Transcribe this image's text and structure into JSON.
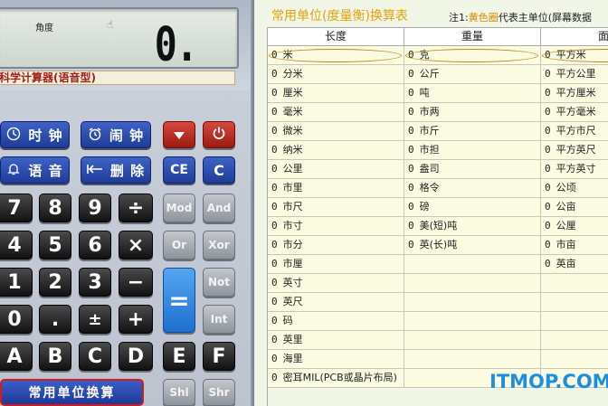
{
  "calculator": {
    "display": {
      "angle_label": "角度",
      "value": "0."
    },
    "model_name": "科学计算器(语音型)",
    "buttons": {
      "clock": "时 钟",
      "alarm": "闹 钟",
      "voice": "语 音",
      "delete": "删 除",
      "ce": "CE",
      "c": "C",
      "digits": [
        "7",
        "8",
        "9",
        "4",
        "5",
        "6",
        "1",
        "2",
        "3",
        "0",
        "."
      ],
      "divide": "÷",
      "multiply": "×",
      "minus": "−",
      "plus": "+",
      "plusminus": "±",
      "equals": "=",
      "hex": [
        "A",
        "B",
        "C",
        "D",
        "E",
        "F"
      ],
      "mod": "Mod",
      "and": "And",
      "or": "Or",
      "xor": "Xor",
      "not": "Not",
      "int": "Int",
      "shl": "Shl",
      "shr": "Shr",
      "unit_convert": "常用单位换算"
    },
    "icons": {
      "clock": "clock-icon",
      "alarm": "alarm-clock-icon",
      "voice": "bell-icon",
      "delete": "backspace-icon",
      "down": "triangle-down-icon",
      "power": "power-icon",
      "cursor": "hand-cursor-icon"
    }
  },
  "converter": {
    "title": "常用单位(度量衡)换算表",
    "note_prefix": "注1:",
    "note_highlight": "黄色圈",
    "note_suffix": "代表主单位(屏幕数据",
    "columns": [
      "长度",
      "重量",
      "面积"
    ],
    "rows": [
      [
        "米",
        "克",
        "平方米"
      ],
      [
        "分米",
        "公斤",
        "平方公里"
      ],
      [
        "厘米",
        "吨",
        "平方厘米"
      ],
      [
        "毫米",
        "市两",
        "平方毫米"
      ],
      [
        "微米",
        "市斤",
        "平方市尺"
      ],
      [
        "纳米",
        "市担",
        "平方英尺"
      ],
      [
        "公里",
        "盎司",
        "平方英寸"
      ],
      [
        "市里",
        "格令",
        "公顷"
      ],
      [
        "市尺",
        "磅",
        "公亩"
      ],
      [
        "市寸",
        "美(短)吨",
        "公厘"
      ],
      [
        "市分",
        "英(长)吨",
        "市亩"
      ],
      [
        "市厘",
        "",
        "英亩"
      ],
      [
        "英寸",
        "",
        ""
      ],
      [
        "英尺",
        "",
        ""
      ],
      [
        "码",
        "",
        ""
      ],
      [
        "英里",
        "",
        ""
      ],
      [
        "海里",
        "",
        ""
      ],
      [
        "密耳MIL(PCB或晶片布局)",
        "",
        ""
      ]
    ],
    "value": "0"
  },
  "watermark": "ITMOP.COM",
  "colors": {
    "title": "#e5a20c",
    "cell_bg": "#fbfbe2",
    "blue_key": "#2a4bb0",
    "red_key": "#c0302a",
    "watermark": "#1c8fe0"
  }
}
